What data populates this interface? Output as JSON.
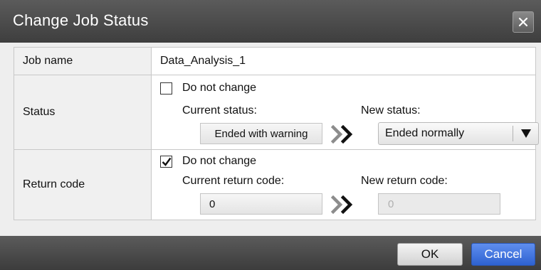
{
  "dialog": {
    "title": "Change Job Status"
  },
  "rows": {
    "job_name": {
      "label": "Job name",
      "value": "Data_Analysis_1"
    },
    "status": {
      "label": "Status",
      "do_not_change_label": "Do not change",
      "do_not_change_checked": false,
      "current_label": "Current status:",
      "current_value": "Ended with warning",
      "new_label": "New status:",
      "new_value": "Ended normally"
    },
    "return_code": {
      "label": "Return code",
      "do_not_change_label": "Do not change",
      "do_not_change_checked": true,
      "current_label": "Current return code:",
      "current_value": "0",
      "new_label": "New return code:",
      "new_value": "0"
    }
  },
  "buttons": {
    "ok": "OK",
    "cancel": "Cancel"
  },
  "colors": {
    "titlebar": "#4a4a4a",
    "cancel": "#3b6fdc"
  }
}
